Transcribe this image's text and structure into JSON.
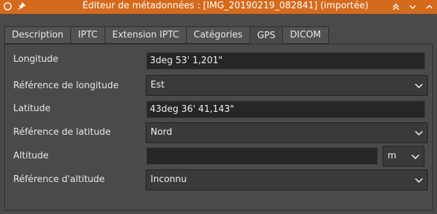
{
  "window": {
    "title": "Éditeur de métadonnées : [IMG_20190219_082841] (importée)",
    "accent": "#d46a1c"
  },
  "tabs": [
    {
      "label": "Description"
    },
    {
      "label": "IPTC"
    },
    {
      "label": "Extension IPTC"
    },
    {
      "label": "Catégories"
    },
    {
      "label": "GPS"
    },
    {
      "label": "DICOM"
    }
  ],
  "gps": {
    "longitude_label": "Longitude",
    "longitude_value": "3deg 53' 1,201\"",
    "longitude_ref_label": "Référence de longitude",
    "longitude_ref_value": "Est",
    "latitude_label": "Latitude",
    "latitude_value": "43deg 36' 41,143\"",
    "latitude_ref_label": "Référence de latitude",
    "latitude_ref_value": "Nord",
    "altitude_label": "Altitude",
    "altitude_value": "",
    "altitude_unit": "m",
    "altitude_ref_label": "Référence d'altitude",
    "altitude_ref_value": "Inconnu"
  }
}
